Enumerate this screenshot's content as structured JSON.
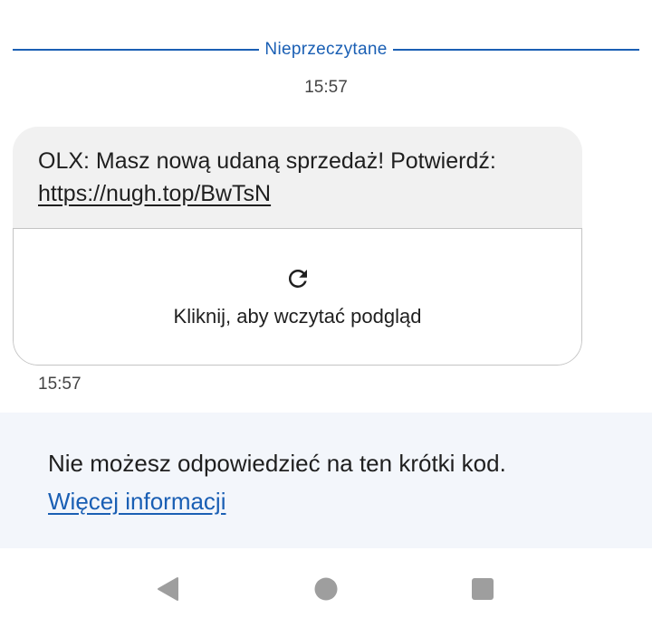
{
  "conversation": {
    "unread_label": "Nieprzeczytane",
    "timestamp_top": "15:57",
    "message": {
      "text": "OLX: Masz nową udaną sprzedaż! Potwierdź:",
      "link": "https://nugh.top/BwTsN",
      "preview_label": "Kliknij, aby wczytać podgląd",
      "preview_icon": "refresh-icon"
    },
    "timestamp_bottom": "15:57"
  },
  "info": {
    "text": "Nie możesz odpowiedzieć na ten krótki kod.",
    "link_label": "Więcej informacji"
  },
  "nav": {
    "back_icon": "back-triangle-icon",
    "home_icon": "home-circle-icon",
    "recents_icon": "recents-square-icon"
  },
  "colors": {
    "accent": "#1a5fb4",
    "bubble_bg": "#f1f1f1",
    "info_bg": "#f3f6fb",
    "nav_icon": "#9e9e9e"
  }
}
